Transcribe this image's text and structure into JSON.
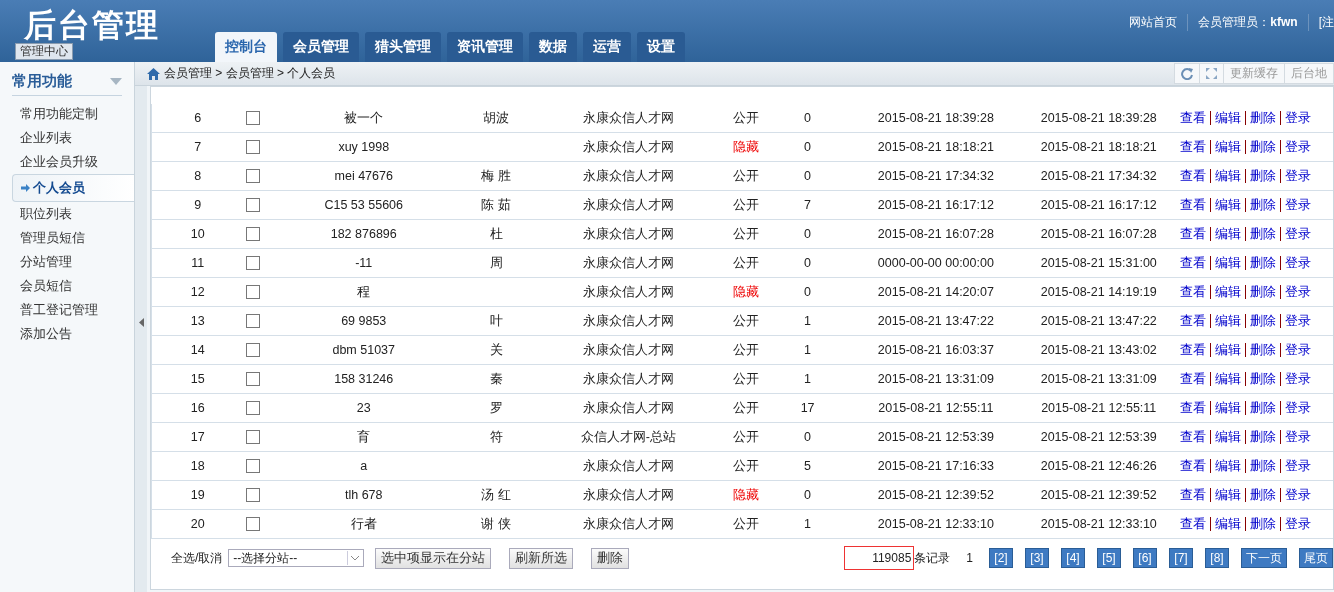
{
  "header": {
    "logo": "后台管理",
    "badge": "管理中心",
    "tabs": [
      {
        "label": "控制台",
        "selected": true
      },
      {
        "label": "会员管理",
        "selected": false
      },
      {
        "label": "猎头管理",
        "selected": false
      },
      {
        "label": "资讯管理",
        "selected": false
      },
      {
        "label": "数据",
        "selected": false
      },
      {
        "label": "运营",
        "selected": false
      },
      {
        "label": "设置",
        "selected": false
      }
    ],
    "links": [
      "网站首页",
      "会员管理员：**kfwn**",
      "[注"
    ]
  },
  "breadcrumb": {
    "path": "会员管理 > 会员管理 > 个人会员",
    "tools": [
      "更新缓存",
      "后台地"
    ]
  },
  "sidebar": {
    "title": "常用功能",
    "items": [
      {
        "label": "常用功能定制",
        "selected": false
      },
      {
        "label": "企业列表",
        "selected": false
      },
      {
        "label": "企业会员升级",
        "selected": false
      },
      {
        "label": "个人会员",
        "selected": true
      },
      {
        "label": "职位列表",
        "selected": false
      },
      {
        "label": "管理员短信",
        "selected": false
      },
      {
        "label": "分站管理",
        "selected": false
      },
      {
        "label": "会员短信",
        "selected": false
      },
      {
        "label": "普工登记管理",
        "selected": false
      },
      {
        "label": "添加公告",
        "selected": false
      }
    ]
  },
  "table": {
    "rows": [
      {
        "no": "6",
        "checked": false,
        "username": "被一个",
        "name": "胡波",
        "site": "永康众信人才网",
        "status": "公开",
        "hidden": false,
        "count": "0",
        "created": "2015-08-21 18:39:28",
        "updated": "2015-08-21 18:39:28",
        "actions": [
          "查看",
          "编辑",
          "删除",
          "登录"
        ]
      },
      {
        "no": "7",
        "checked": false,
        "username": "xuy 1998",
        "name": "",
        "site": "永康众信人才网",
        "status": "隐藏",
        "hidden": true,
        "count": "0",
        "created": "2015-08-21 18:18:21",
        "updated": "2015-08-21 18:18:21",
        "actions": [
          "查看",
          "编辑",
          "删除",
          "登录"
        ]
      },
      {
        "no": "8",
        "checked": false,
        "username": "mei 47676",
        "name": "梅 胜",
        "site": "永康众信人才网",
        "status": "公开",
        "hidden": false,
        "count": "0",
        "created": "2015-08-21 17:34:32",
        "updated": "2015-08-21 17:34:32",
        "actions": [
          "查看",
          "编辑",
          "删除",
          "登录"
        ]
      },
      {
        "no": "9",
        "checked": false,
        "username": "C15 53 55606",
        "name": "陈 茹",
        "site": "永康众信人才网",
        "status": "公开",
        "hidden": false,
        "count": "7",
        "created": "2015-08-21 16:17:12",
        "updated": "2015-08-21 16:17:12",
        "actions": [
          "查看",
          "编辑",
          "删除",
          "登录"
        ]
      },
      {
        "no": "10",
        "checked": false,
        "username": "182 876896",
        "name": "杜",
        "site": "永康众信人才网",
        "status": "公开",
        "hidden": false,
        "count": "0",
        "created": "2015-08-21 16:07:28",
        "updated": "2015-08-21 16:07:28",
        "actions": [
          "查看",
          "编辑",
          "删除",
          "登录"
        ]
      },
      {
        "no": "11",
        "checked": false,
        "username": "-11",
        "name": "周",
        "site": "永康众信人才网",
        "status": "公开",
        "hidden": false,
        "count": "0",
        "created": "0000-00-00 00:00:00",
        "updated": "2015-08-21 15:31:00",
        "actions": [
          "查看",
          "编辑",
          "删除",
          "登录"
        ]
      },
      {
        "no": "12",
        "checked": false,
        "username": "程",
        "name": "",
        "site": "永康众信人才网",
        "status": "隐藏",
        "hidden": true,
        "count": "0",
        "created": "2015-08-21 14:20:07",
        "updated": "2015-08-21 14:19:19",
        "actions": [
          "查看",
          "编辑",
          "删除",
          "登录"
        ]
      },
      {
        "no": "13",
        "checked": false,
        "username": "69 9853",
        "name": "叶",
        "site": "永康众信人才网",
        "status": "公开",
        "hidden": false,
        "count": "1",
        "created": "2015-08-21 13:47:22",
        "updated": "2015-08-21 13:47:22",
        "actions": [
          "查看",
          "编辑",
          "删除",
          "登录"
        ]
      },
      {
        "no": "14",
        "checked": false,
        "username": "dbm 51037",
        "name": "关",
        "site": "永康众信人才网",
        "status": "公开",
        "hidden": false,
        "count": "1",
        "created": "2015-08-21 16:03:37",
        "updated": "2015-08-21 13:43:02",
        "actions": [
          "查看",
          "编辑",
          "删除",
          "登录"
        ]
      },
      {
        "no": "15",
        "checked": false,
        "username": "158 31246",
        "name": "秦",
        "site": "永康众信人才网",
        "status": "公开",
        "hidden": false,
        "count": "1",
        "created": "2015-08-21 13:31:09",
        "updated": "2015-08-21 13:31:09",
        "actions": [
          "查看",
          "编辑",
          "删除",
          "登录"
        ]
      },
      {
        "no": "16",
        "checked": false,
        "username": "23",
        "name": "罗",
        "site": "永康众信人才网",
        "status": "公开",
        "hidden": false,
        "count": "17",
        "created": "2015-08-21 12:55:11",
        "updated": "2015-08-21 12:55:11",
        "actions": [
          "查看",
          "编辑",
          "删除",
          "登录"
        ]
      },
      {
        "no": "17",
        "checked": false,
        "username": "育",
        "name": "符",
        "site": "众信人才网-总站",
        "status": "公开",
        "hidden": false,
        "count": "0",
        "created": "2015-08-21 12:53:39",
        "updated": "2015-08-21 12:53:39",
        "actions": [
          "查看",
          "编辑",
          "删除",
          "登录"
        ]
      },
      {
        "no": "18",
        "checked": false,
        "username": "a",
        "name": "",
        "site": "永康众信人才网",
        "status": "公开",
        "hidden": false,
        "count": "5",
        "created": "2015-08-21 17:16:33",
        "updated": "2015-08-21 12:46:26",
        "actions": [
          "查看",
          "编辑",
          "删除",
          "登录"
        ]
      },
      {
        "no": "19",
        "checked": false,
        "username": "tlh 678",
        "name": "汤 红",
        "site": "永康众信人才网",
        "status": "隐藏",
        "hidden": true,
        "count": "0",
        "created": "2015-08-21 12:39:52",
        "updated": "2015-08-21 12:39:52",
        "actions": [
          "查看",
          "编辑",
          "删除",
          "登录"
        ]
      },
      {
        "no": "20",
        "checked": false,
        "username": "行者",
        "name": "谢 侠",
        "site": "永康众信人才网",
        "status": "公开",
        "hidden": false,
        "count": "1",
        "created": "2015-08-21 12:33:10",
        "updated": "2015-08-21 12:33:10",
        "actions": [
          "查看",
          "编辑",
          "删除",
          "登录"
        ]
      }
    ]
  },
  "footer": {
    "select_all": "全选/取消",
    "branch_select": {
      "value": "--选择分站--"
    },
    "buttons": [
      "选中项显示在分站",
      "刷新所选",
      "删除"
    ],
    "total": "119085",
    "total_label": "条记录",
    "pages": [
      {
        "label": "1",
        "selected": true
      },
      {
        "label": "[2]",
        "selected": false
      },
      {
        "label": "[3]",
        "selected": false
      },
      {
        "label": "[4]",
        "selected": false
      },
      {
        "label": "[5]",
        "selected": false
      },
      {
        "label": "[6]",
        "selected": false
      },
      {
        "label": "[7]",
        "selected": false
      },
      {
        "label": "[8]",
        "selected": false
      },
      {
        "label": "下一页",
        "selected": false
      },
      {
        "label": "尾页",
        "selected": false
      }
    ]
  }
}
